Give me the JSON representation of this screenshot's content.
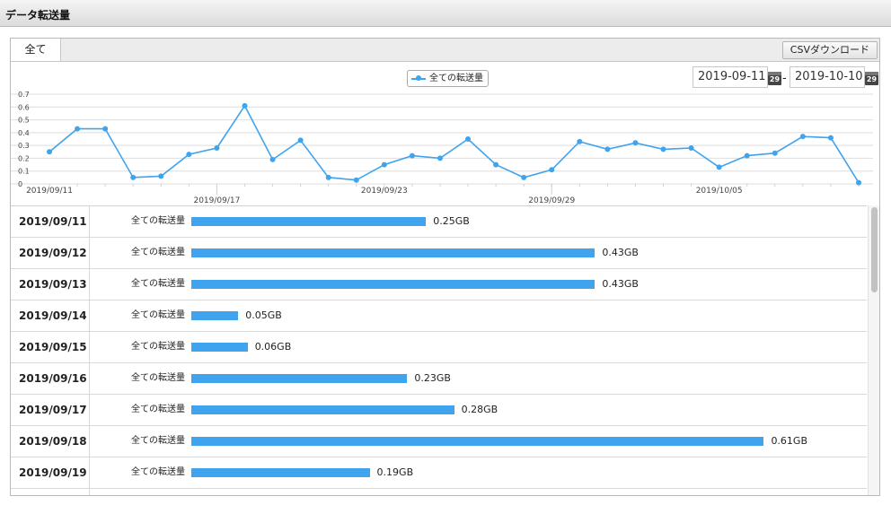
{
  "header": {
    "title": "データ転送量"
  },
  "tabs": [
    {
      "label": "全て"
    }
  ],
  "toolbar": {
    "csv_label": "CSVダウンロード"
  },
  "date_range": {
    "start": "2019-09-11",
    "end": "2019-10-10",
    "separator": "-",
    "calendar_day": "29"
  },
  "legend": {
    "series_name": "全ての転送量"
  },
  "colors": {
    "series": "#3fa3ee"
  },
  "chart_data": {
    "type": "line",
    "title": "",
    "xlabel": "",
    "ylabel": "",
    "ylim": [
      0,
      0.7
    ],
    "yticks": [
      "0",
      "0.1",
      "0.2",
      "0.3",
      "0.4",
      "0.5",
      "0.6",
      "0.7"
    ],
    "xtick_labels": [
      {
        "index": 0,
        "label": "2019/09/11"
      },
      {
        "index": 6,
        "label": "2019/09/17"
      },
      {
        "index": 12,
        "label": "2019/09/23"
      },
      {
        "index": 18,
        "label": "2019/09/29"
      },
      {
        "index": 24,
        "label": "2019/10/05"
      }
    ],
    "grid": true,
    "legend_position": "top-center",
    "series": [
      {
        "name": "全ての転送量",
        "x": [
          "2019/09/11",
          "2019/09/12",
          "2019/09/13",
          "2019/09/14",
          "2019/09/15",
          "2019/09/16",
          "2019/09/17",
          "2019/09/18",
          "2019/09/19",
          "2019/09/20",
          "2019/09/21",
          "2019/09/22",
          "2019/09/23",
          "2019/09/24",
          "2019/09/25",
          "2019/09/26",
          "2019/09/27",
          "2019/09/28",
          "2019/09/29",
          "2019/09/30",
          "2019/10/01",
          "2019/10/02",
          "2019/10/03",
          "2019/10/04",
          "2019/10/05",
          "2019/10/06",
          "2019/10/07",
          "2019/10/08",
          "2019/10/09",
          "2019/10/10"
        ],
        "values": [
          0.25,
          0.43,
          0.43,
          0.05,
          0.06,
          0.23,
          0.28,
          0.61,
          0.19,
          0.34,
          0.05,
          0.03,
          0.15,
          0.22,
          0.2,
          0.35,
          0.15,
          0.05,
          0.11,
          0.33,
          0.27,
          0.32,
          0.27,
          0.28,
          0.13,
          0.22,
          0.24,
          0.37,
          0.36,
          0.01
        ]
      }
    ]
  },
  "table": {
    "series_label": "全ての転送量",
    "rows": [
      {
        "date": "2019/09/11",
        "value": 0.25,
        "value_text": "0.25GB"
      },
      {
        "date": "2019/09/12",
        "value": 0.43,
        "value_text": "0.43GB"
      },
      {
        "date": "2019/09/13",
        "value": 0.43,
        "value_text": "0.43GB"
      },
      {
        "date": "2019/09/14",
        "value": 0.05,
        "value_text": "0.05GB"
      },
      {
        "date": "2019/09/15",
        "value": 0.06,
        "value_text": "0.06GB"
      },
      {
        "date": "2019/09/16",
        "value": 0.23,
        "value_text": "0.23GB"
      },
      {
        "date": "2019/09/17",
        "value": 0.28,
        "value_text": "0.28GB"
      },
      {
        "date": "2019/09/18",
        "value": 0.61,
        "value_text": "0.61GB"
      },
      {
        "date": "2019/09/19",
        "value": 0.19,
        "value_text": "0.19GB"
      },
      {
        "date": "",
        "value": 0,
        "value_text": ""
      }
    ]
  },
  "scrollbar": {
    "position_fraction": 0
  }
}
